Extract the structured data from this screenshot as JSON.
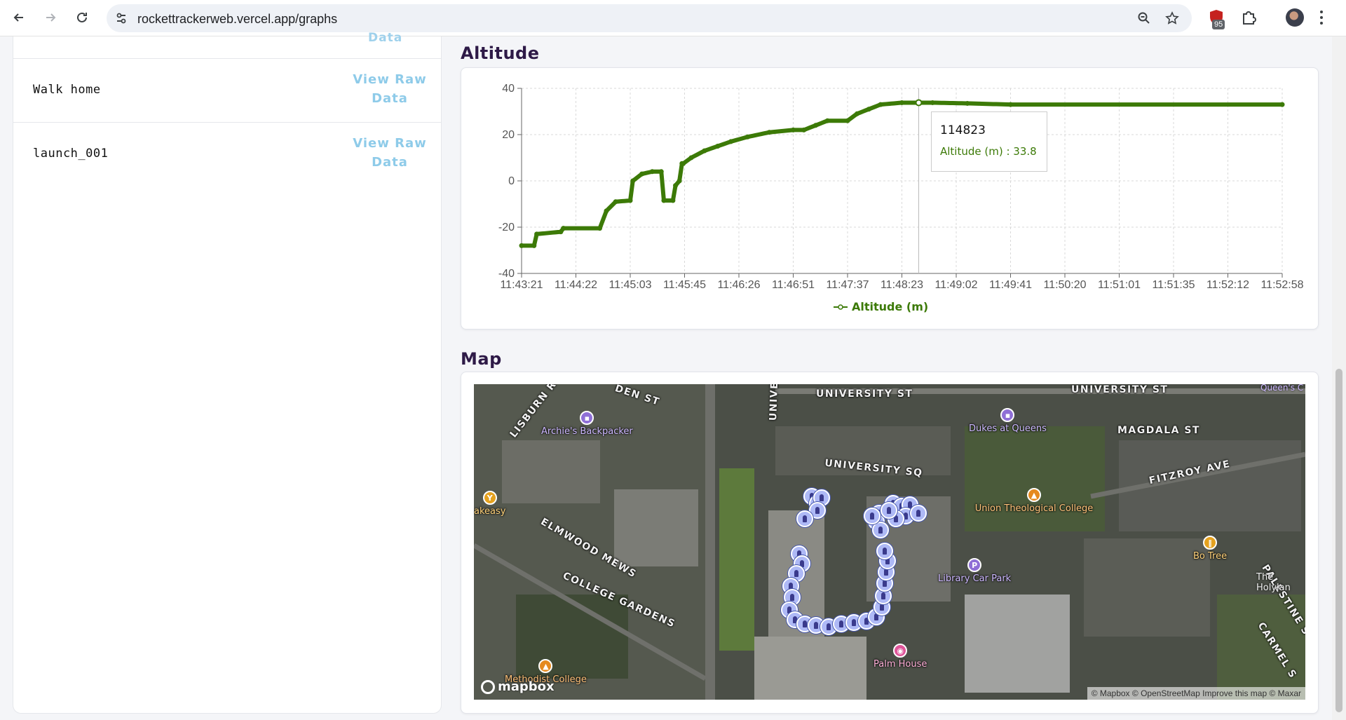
{
  "browser": {
    "url": "rockettrackerweb.vercel.app/graphs",
    "extension_badge": "95"
  },
  "sidebar": {
    "clipped_text": "Data",
    "flights": [
      {
        "name": "Walk home",
        "action": "View Raw Data"
      },
      {
        "name": "launch_001",
        "action": "View Raw Data"
      }
    ]
  },
  "altitude": {
    "section_title": "Altitude",
    "tooltip": {
      "label": "114823",
      "value_text": "Altitude (m) : 33.8"
    },
    "legend": "Altitude (m)"
  },
  "map": {
    "section_title": "Map",
    "streets": [
      "UNIVERSITY ST",
      "UNIVERSITY ST",
      "UNIVERSITY SQ",
      "MAGDALA ST",
      "FITZROY AVE",
      "ELMWOOD MEWS",
      "COLLEGE GARDENS",
      "LISBURN R",
      "DEN ST",
      "UNIVE",
      "PALESTINE S",
      "CARMEL S"
    ],
    "pois": [
      "Archie's Backpacker",
      "Dukes at Queens",
      "Union Theological College",
      "Library Car Park",
      "Bo Tree",
      "Palm House",
      "Methodist College",
      "akeasy",
      "The Holylan",
      "Queen's C"
    ],
    "logo": "mapbox",
    "attribution": "© Mapbox © OpenStreetMap  Improve this map © Maxar"
  },
  "colors": {
    "series": "#3c7a07",
    "title": "#2e1a47",
    "link": "#8ecbe9",
    "marker": "#aeb9f6"
  },
  "chart_data": {
    "type": "line",
    "title": "",
    "xlabel": "",
    "ylabel": "",
    "ylim": [
      -40,
      40
    ],
    "yticks": [
      40,
      20,
      0,
      -20,
      -40
    ],
    "xticks": [
      "11:43:21",
      "11:44:22",
      "11:45:03",
      "11:45:45",
      "11:46:26",
      "11:46:51",
      "11:47:37",
      "11:48:23",
      "11:49:02",
      "11:49:41",
      "11:50:20",
      "11:51:01",
      "11:51:35",
      "11:52:12",
      "11:52:58"
    ],
    "grid": true,
    "legend_position": "bottom",
    "series": [
      {
        "name": "Altitude (m)",
        "x": [
          "11:43:21",
          "11:43:35",
          "11:43:38",
          "11:44:05",
          "11:44:08",
          "11:44:40",
          "11:44:45",
          "11:44:52",
          "11:45:03",
          "11:45:05",
          "11:45:12",
          "11:45:20",
          "11:45:27",
          "11:45:29",
          "11:45:36",
          "11:45:38",
          "11:45:41",
          "11:45:43",
          "11:45:44",
          "11:45:50",
          "11:46:00",
          "11:46:10",
          "11:46:20",
          "11:46:30",
          "11:46:40",
          "11:46:51",
          "11:47:00",
          "11:47:10",
          "11:47:20",
          "11:47:37",
          "11:47:45",
          "11:47:55",
          "11:48:05",
          "11:48:23",
          "11:48:45",
          "11:49:10",
          "11:49:41",
          "11:52:58"
        ],
        "values": [
          -28,
          -28,
          -23,
          -22,
          -20.5,
          -20.5,
          -13,
          -9,
          -8.5,
          0,
          3,
          4,
          4,
          -8.5,
          -8.5,
          -2,
          0,
          7.5,
          7.5,
          10,
          13,
          15,
          17,
          19,
          21,
          22,
          22,
          24,
          26,
          26,
          29,
          31,
          33,
          33.8,
          33.8,
          33.5,
          33,
          33
        ]
      }
    ]
  }
}
